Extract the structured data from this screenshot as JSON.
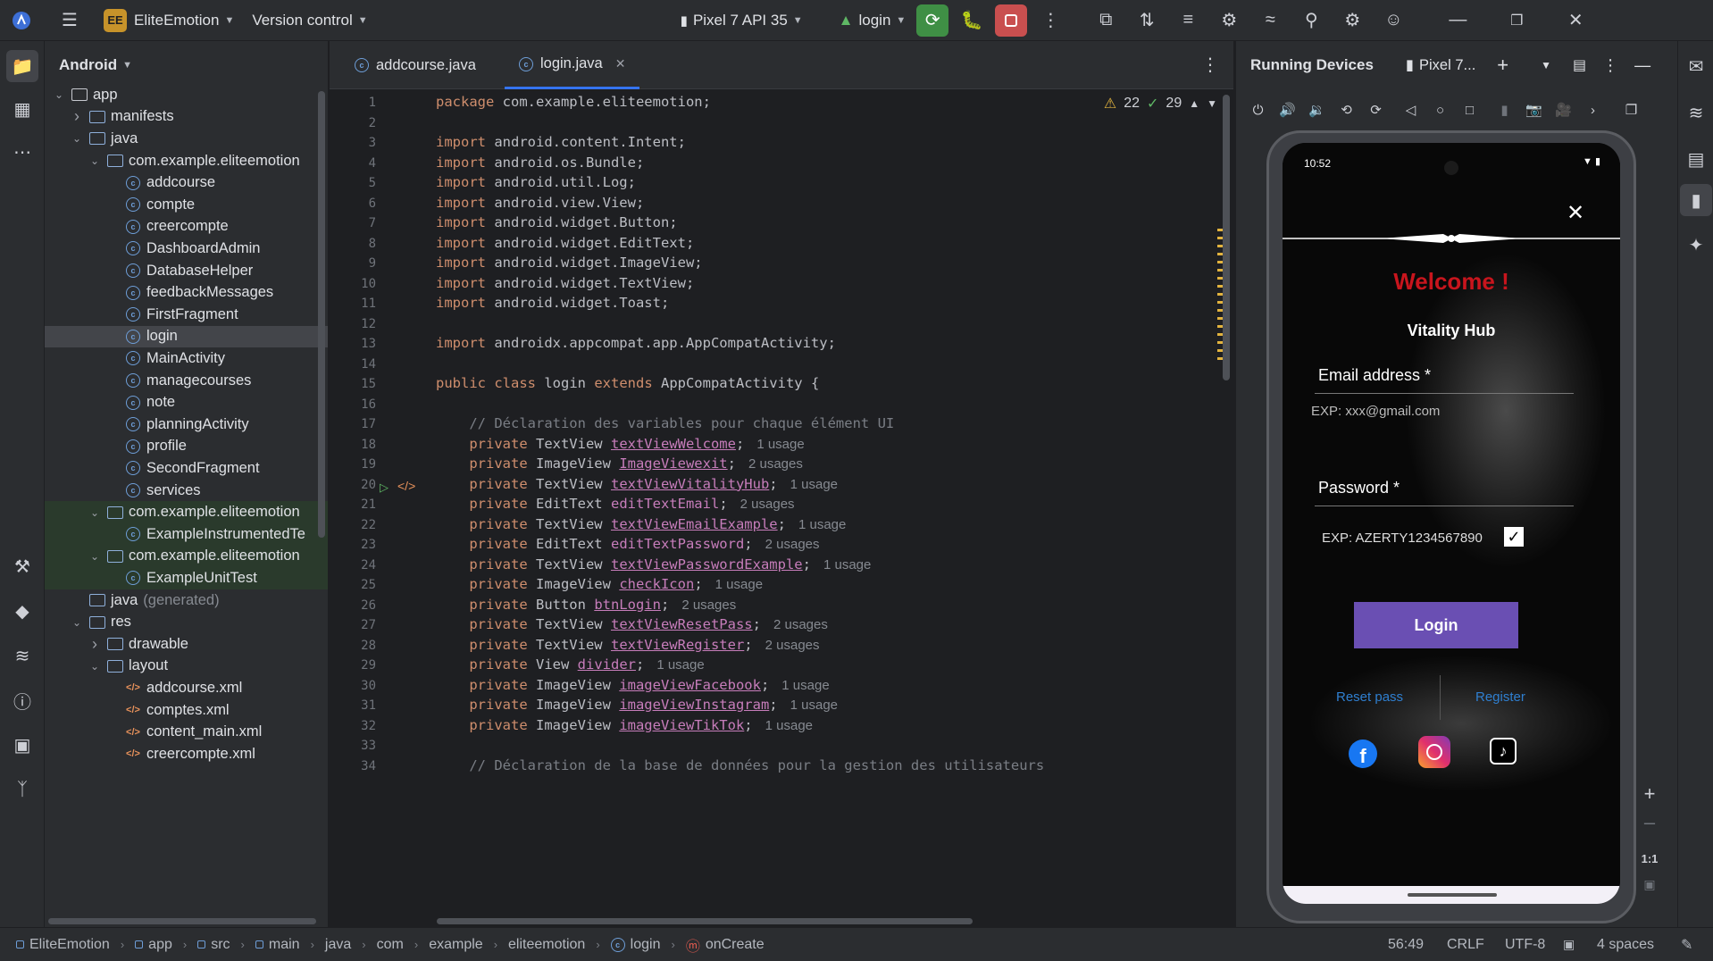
{
  "topbar": {
    "project_badge": "EE",
    "project_name": "EliteEmotion",
    "version_control": "Version control",
    "device": "Pixel 7 API 35",
    "run_config": "login"
  },
  "project_panel": {
    "view": "Android",
    "tree": [
      {
        "label": "app",
        "kind": "module",
        "arrow": "open",
        "indent": 0
      },
      {
        "label": "manifests",
        "kind": "folder",
        "arrow": "closed",
        "indent": 1
      },
      {
        "label": "java",
        "kind": "folder",
        "arrow": "open",
        "indent": 1
      },
      {
        "label": "com.example.eliteemotion",
        "kind": "package",
        "arrow": "open",
        "indent": 2
      },
      {
        "label": "addcourse",
        "kind": "class",
        "arrow": "",
        "indent": 3
      },
      {
        "label": "compte",
        "kind": "class",
        "arrow": "",
        "indent": 3
      },
      {
        "label": "creercompte",
        "kind": "class",
        "arrow": "",
        "indent": 3
      },
      {
        "label": "DashboardAdmin",
        "kind": "class",
        "arrow": "",
        "indent": 3
      },
      {
        "label": "DatabaseHelper",
        "kind": "class",
        "arrow": "",
        "indent": 3
      },
      {
        "label": "feedbackMessages",
        "kind": "class",
        "arrow": "",
        "indent": 3
      },
      {
        "label": "FirstFragment",
        "kind": "class",
        "arrow": "",
        "indent": 3
      },
      {
        "label": "login",
        "kind": "class",
        "arrow": "",
        "indent": 3,
        "selected": true
      },
      {
        "label": "MainActivity",
        "kind": "class",
        "arrow": "",
        "indent": 3
      },
      {
        "label": "managecourses",
        "kind": "class",
        "arrow": "",
        "indent": 3
      },
      {
        "label": "note",
        "kind": "class",
        "arrow": "",
        "indent": 3
      },
      {
        "label": "planningActivity",
        "kind": "class",
        "arrow": "",
        "indent": 3
      },
      {
        "label": "profile",
        "kind": "class",
        "arrow": "",
        "indent": 3
      },
      {
        "label": "SecondFragment",
        "kind": "class",
        "arrow": "",
        "indent": 3
      },
      {
        "label": "services",
        "kind": "class",
        "arrow": "",
        "indent": 3
      },
      {
        "label": "com.example.eliteemotion",
        "kind": "package",
        "arrow": "open",
        "indent": 2,
        "test": true
      },
      {
        "label": "ExampleInstrumentedTe",
        "kind": "class",
        "arrow": "",
        "indent": 3,
        "test": true
      },
      {
        "label": "com.example.eliteemotion",
        "kind": "package",
        "arrow": "open",
        "indent": 2,
        "test": true
      },
      {
        "label": "ExampleUnitTest",
        "kind": "class",
        "arrow": "",
        "indent": 3,
        "test": true
      },
      {
        "label": "java",
        "suffix": "(generated)",
        "kind": "folder",
        "arrow": "",
        "indent": 1
      },
      {
        "label": "res",
        "kind": "folder",
        "arrow": "open",
        "indent": 1
      },
      {
        "label": "drawable",
        "kind": "folder",
        "arrow": "closed",
        "indent": 2
      },
      {
        "label": "layout",
        "kind": "folder",
        "arrow": "open",
        "indent": 2
      },
      {
        "label": "addcourse.xml",
        "kind": "xml",
        "arrow": "",
        "indent": 3
      },
      {
        "label": "comptes.xml",
        "kind": "xml",
        "arrow": "",
        "indent": 3
      },
      {
        "label": "content_main.xml",
        "kind": "xml",
        "arrow": "",
        "indent": 3
      },
      {
        "label": "creercompte.xml",
        "kind": "xml",
        "arrow": "",
        "indent": 3
      }
    ]
  },
  "editor": {
    "tabs": [
      {
        "label": "addcourse.java",
        "active": false
      },
      {
        "label": "login.java",
        "active": true
      }
    ],
    "warnings": "22",
    "checks": "29",
    "lines": [
      [
        {
          "t": "package ",
          "c": "kw"
        },
        {
          "t": "com.example.eliteemotion;",
          "c": ""
        }
      ],
      [],
      [
        {
          "t": "import ",
          "c": "kw"
        },
        {
          "t": "android.content.Intent;",
          "c": ""
        }
      ],
      [
        {
          "t": "import ",
          "c": "kw"
        },
        {
          "t": "android.os.Bundle;",
          "c": ""
        }
      ],
      [
        {
          "t": "import ",
          "c": "kw"
        },
        {
          "t": "android.util.Log;",
          "c": ""
        }
      ],
      [
        {
          "t": "import ",
          "c": "kw"
        },
        {
          "t": "android.view.View;",
          "c": ""
        }
      ],
      [
        {
          "t": "import ",
          "c": "kw"
        },
        {
          "t": "android.widget.Button;",
          "c": ""
        }
      ],
      [
        {
          "t": "import ",
          "c": "kw"
        },
        {
          "t": "android.widget.EditText;",
          "c": ""
        }
      ],
      [
        {
          "t": "import ",
          "c": "kw"
        },
        {
          "t": "android.widget.ImageView;",
          "c": ""
        }
      ],
      [
        {
          "t": "import ",
          "c": "kw"
        },
        {
          "t": "android.widget.TextView;",
          "c": ""
        }
      ],
      [
        {
          "t": "import ",
          "c": "kw"
        },
        {
          "t": "android.widget.Toast;",
          "c": ""
        }
      ],
      [],
      [
        {
          "t": "import ",
          "c": "kw"
        },
        {
          "t": "androidx.appcompat.app.AppCompatActivity;",
          "c": ""
        }
      ],
      [],
      [
        {
          "t": "public class ",
          "c": "kw"
        },
        {
          "t": "login ",
          "c": ""
        },
        {
          "t": "extends ",
          "c": "kw"
        },
        {
          "t": "AppCompatActivity {",
          "c": ""
        }
      ],
      [],
      [
        {
          "t": "    // Déclaration des variables pour chaque élément UI",
          "c": "cm"
        }
      ],
      [
        {
          "t": "    private ",
          "c": "kw"
        },
        {
          "t": "TextView ",
          "c": ""
        },
        {
          "t": "textViewWelcome",
          "c": "fld-u"
        },
        {
          "t": ";",
          "c": ""
        },
        {
          "t": "1 usage",
          "c": "hint"
        }
      ],
      [
        {
          "t": "    private ",
          "c": "kw"
        },
        {
          "t": "ImageView ",
          "c": ""
        },
        {
          "t": "ImageViewexit",
          "c": "fld-u"
        },
        {
          "t": ";",
          "c": ""
        },
        {
          "t": "2 usages",
          "c": "hint"
        }
      ],
      [
        {
          "t": "    private ",
          "c": "kw"
        },
        {
          "t": "TextView ",
          "c": ""
        },
        {
          "t": "textViewVitalityHub",
          "c": "fld-u"
        },
        {
          "t": ";",
          "c": ""
        },
        {
          "t": "1 usage",
          "c": "hint"
        }
      ],
      [
        {
          "t": "    private ",
          "c": "kw"
        },
        {
          "t": "EditText ",
          "c": ""
        },
        {
          "t": "editTextEmail",
          "c": "fld"
        },
        {
          "t": ";",
          "c": ""
        },
        {
          "t": "2 usages",
          "c": "hint"
        }
      ],
      [
        {
          "t": "    private ",
          "c": "kw"
        },
        {
          "t": "TextView ",
          "c": ""
        },
        {
          "t": "textViewEmailExample",
          "c": "fld-u"
        },
        {
          "t": ";",
          "c": ""
        },
        {
          "t": "1 usage",
          "c": "hint"
        }
      ],
      [
        {
          "t": "    private ",
          "c": "kw"
        },
        {
          "t": "EditText ",
          "c": ""
        },
        {
          "t": "editTextPassword",
          "c": "fld"
        },
        {
          "t": ";",
          "c": ""
        },
        {
          "t": "2 usages",
          "c": "hint"
        }
      ],
      [
        {
          "t": "    private ",
          "c": "kw"
        },
        {
          "t": "TextView ",
          "c": ""
        },
        {
          "t": "textViewPasswordExample",
          "c": "fld-u"
        },
        {
          "t": ";",
          "c": ""
        },
        {
          "t": "1 usage",
          "c": "hint"
        }
      ],
      [
        {
          "t": "    private ",
          "c": "kw"
        },
        {
          "t": "ImageView ",
          "c": ""
        },
        {
          "t": "checkIcon",
          "c": "fld-u"
        },
        {
          "t": ";",
          "c": ""
        },
        {
          "t": "1 usage",
          "c": "hint"
        }
      ],
      [
        {
          "t": "    private ",
          "c": "kw"
        },
        {
          "t": "Button ",
          "c": ""
        },
        {
          "t": "btnLogin",
          "c": "fld-u"
        },
        {
          "t": ";",
          "c": ""
        },
        {
          "t": "2 usages",
          "c": "hint"
        }
      ],
      [
        {
          "t": "    private ",
          "c": "kw"
        },
        {
          "t": "TextView ",
          "c": ""
        },
        {
          "t": "textViewResetPass",
          "c": "fld-u"
        },
        {
          "t": ";",
          "c": ""
        },
        {
          "t": "2 usages",
          "c": "hint"
        }
      ],
      [
        {
          "t": "    private ",
          "c": "kw"
        },
        {
          "t": "TextView ",
          "c": ""
        },
        {
          "t": "textViewRegister",
          "c": "fld-u"
        },
        {
          "t": ";",
          "c": ""
        },
        {
          "t": "2 usages",
          "c": "hint"
        }
      ],
      [
        {
          "t": "    private ",
          "c": "kw"
        },
        {
          "t": "View ",
          "c": ""
        },
        {
          "t": "divider",
          "c": "fld-u"
        },
        {
          "t": ";",
          "c": ""
        },
        {
          "t": "1 usage",
          "c": "hint"
        }
      ],
      [
        {
          "t": "    private ",
          "c": "kw"
        },
        {
          "t": "ImageView ",
          "c": ""
        },
        {
          "t": "imageViewFacebook",
          "c": "fld-u"
        },
        {
          "t": ";",
          "c": ""
        },
        {
          "t": "1 usage",
          "c": "hint"
        }
      ],
      [
        {
          "t": "    private ",
          "c": "kw"
        },
        {
          "t": "ImageView ",
          "c": ""
        },
        {
          "t": "imageViewInstagram",
          "c": "fld-u"
        },
        {
          "t": ";",
          "c": ""
        },
        {
          "t": "1 usage",
          "c": "hint"
        }
      ],
      [
        {
          "t": "    private ",
          "c": "kw"
        },
        {
          "t": "ImageView ",
          "c": ""
        },
        {
          "t": "imageViewTikTok",
          "c": "fld-u"
        },
        {
          "t": ";",
          "c": ""
        },
        {
          "t": "1 usage",
          "c": "hint"
        }
      ],
      [],
      [
        {
          "t": "    // Déclaration de la base de données pour la gestion des utilisateurs",
          "c": "cm"
        }
      ]
    ]
  },
  "devices": {
    "title": "Running Devices",
    "device_tab": "Pixel 7...",
    "zoom_label": "1:1"
  },
  "phone": {
    "time": "10:52",
    "welcome": "Welcome !",
    "brand": "Vitality Hub",
    "email_label": "Email address *",
    "email_hint": "EXP: xxx@gmail.com",
    "password_label": "Password *",
    "password_hint": "EXP: AZERTY1234567890",
    "login_button": "Login",
    "reset_link": "Reset pass",
    "register_link": "Register"
  },
  "statusbar": {
    "breadcrumbs": [
      "EliteEmotion",
      "app",
      "src",
      "main",
      "java",
      "com",
      "example",
      "eliteemotion",
      "login",
      "onCreate"
    ],
    "position": "56:49",
    "line_sep": "CRLF",
    "encoding": "UTF-8",
    "indent": "4 spaces"
  },
  "colors": {
    "accent": "#3574f0",
    "keyword": "#cf8e6d",
    "field": "#c77dbb",
    "welcome_red": "#c8151d",
    "login_button": "#6a4fb3",
    "link_blue": "#2f7fd0"
  }
}
